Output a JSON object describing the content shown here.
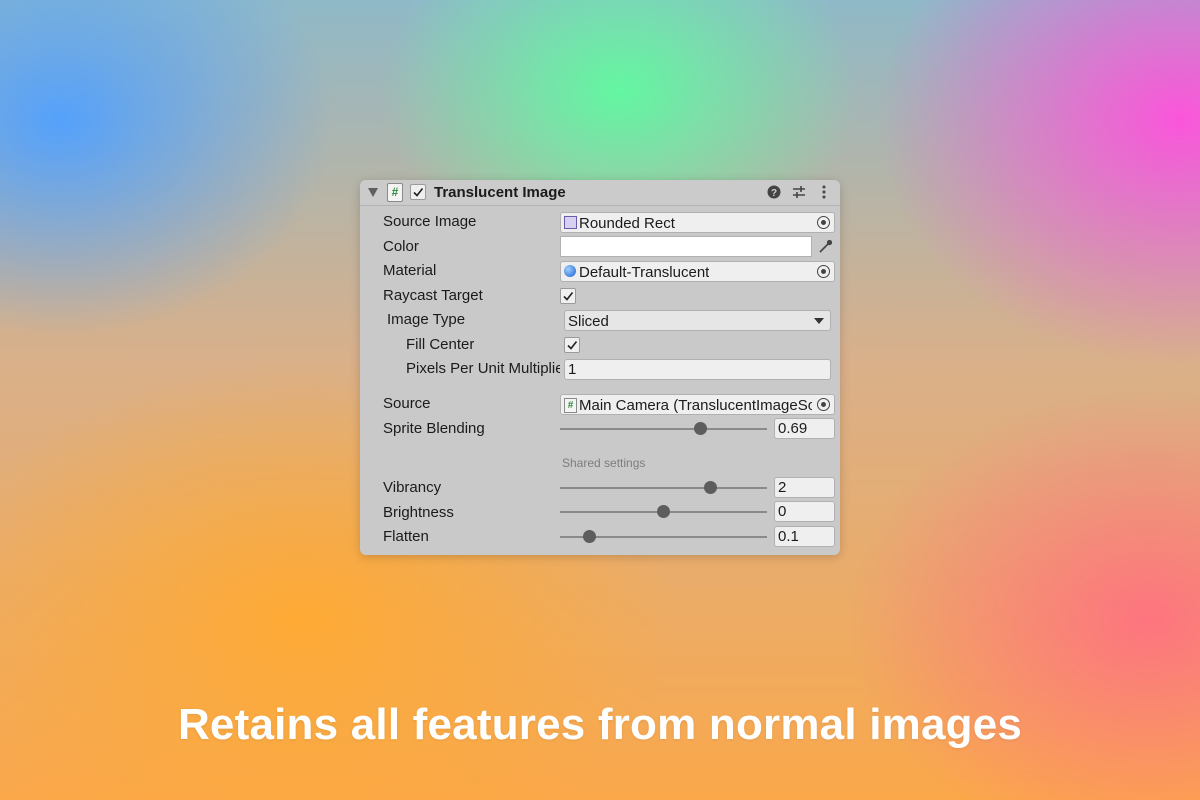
{
  "header": {
    "title": "Translucent Image",
    "script_icon_glyph": "#",
    "icons": [
      "help-icon",
      "presets-icon",
      "more-icon"
    ]
  },
  "fields": {
    "source_image": {
      "label": "Source Image",
      "value": "Rounded Rect",
      "icon": "sprite-icon"
    },
    "color": {
      "label": "Color",
      "value": "#ffffff",
      "icon": "eyedropper-icon"
    },
    "material": {
      "label": "Material",
      "value": "Default-Translucent",
      "icon": "material-sphere-icon"
    },
    "raycast_target": {
      "label": "Raycast Target",
      "checked": true
    },
    "image_type": {
      "label": "Image Type",
      "value": "Sliced"
    },
    "fill_center": {
      "label": "Fill Center",
      "checked": true
    },
    "pixels_per_unit": {
      "label": "Pixels Per Unit Multiplier",
      "value": "1"
    },
    "source": {
      "label": "Source",
      "value": "Main Camera (TranslucentImageSource)",
      "icon": "script-icon"
    },
    "sprite_blending": {
      "label": "Sprite Blending",
      "value": "0.69",
      "fraction": 0.69
    }
  },
  "shared_settings": {
    "heading": "Shared settings",
    "vibrancy": {
      "label": "Vibrancy",
      "value": "2",
      "fraction": 0.74
    },
    "brightness": {
      "label": "Brightness",
      "value": "0",
      "fraction": 0.5
    },
    "flatten": {
      "label": "Flatten",
      "value": "0.1",
      "fraction": 0.12
    }
  },
  "caption": "Retains all features from normal images",
  "colors": {
    "panel_bg": "#c9c9c9",
    "field_bg": "#efefef",
    "slider_knob": "#5d5d5d",
    "caption": "#ffffff"
  }
}
